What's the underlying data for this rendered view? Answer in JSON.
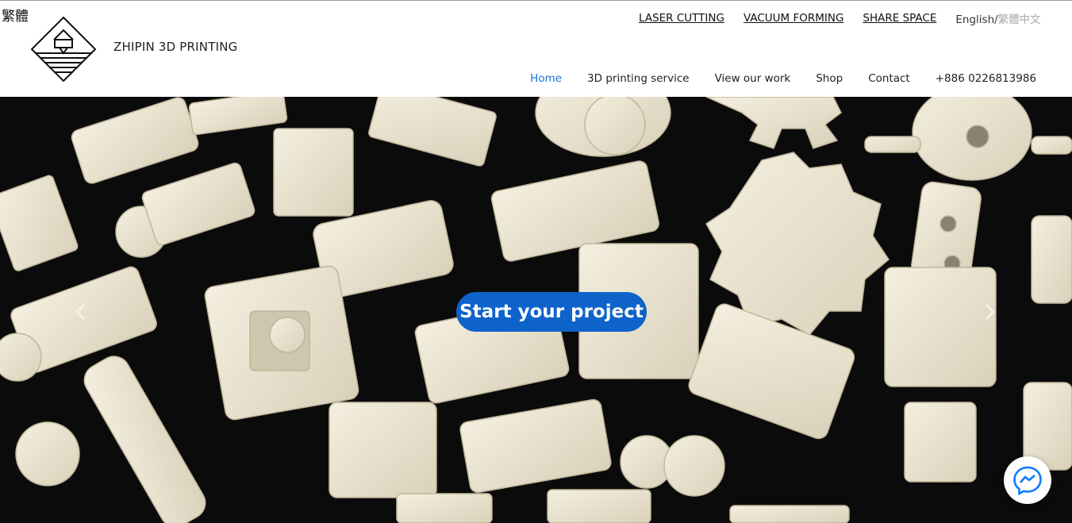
{
  "corner_lang": "繁體",
  "brand": {
    "name": "ZHIPIN 3D PRINTING",
    "logo_icon": "printer-nozzle-logo-icon"
  },
  "top_links": [
    "LASER CUTTING",
    "VACUUM FORMING",
    "SHARE SPACE"
  ],
  "language_switch": {
    "current": "English/",
    "alternate": "繁體中文"
  },
  "nav": {
    "items": [
      "Home",
      "3D printing service",
      "View our work",
      "Shop",
      "Contact",
      "+886 0226813986"
    ],
    "active": "Home"
  },
  "hero": {
    "cta_label": "Start your project",
    "prev_icon": "chevron-left-icon",
    "next_icon": "chevron-right-icon"
  },
  "chat_widget": {
    "icon": "messenger-icon"
  },
  "colors": {
    "accent": "#1a73d9",
    "cta_background": "#0d63c9",
    "hero_background": "#0b0b0b"
  }
}
